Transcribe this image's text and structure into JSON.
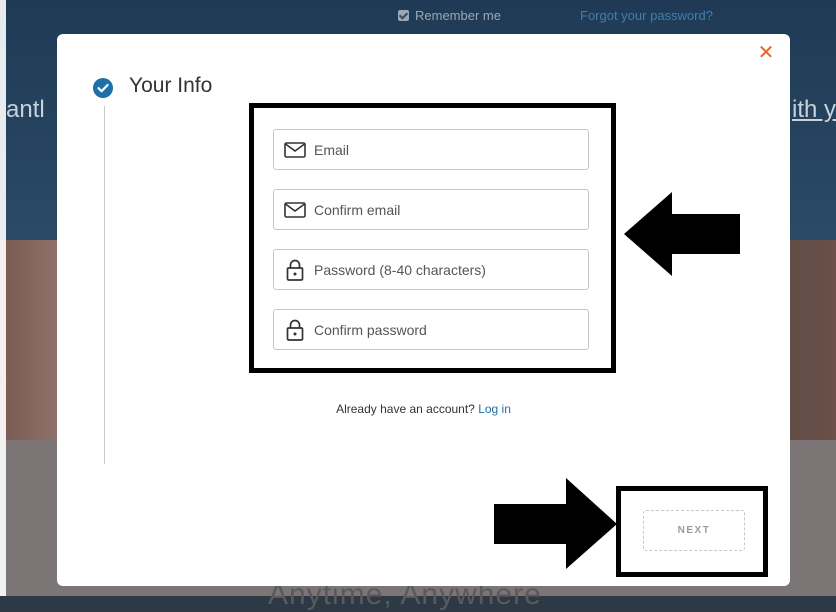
{
  "background": {
    "remember_label": "Remember me",
    "forgot_link": "Forgot your password?",
    "left_fragment": "antl",
    "right_fragment": "ith y",
    "tagline": "Anytime, Anywhere"
  },
  "modal": {
    "close_glyph": "✕",
    "step_title": "Your Info",
    "fields": [
      {
        "placeholder": "Email",
        "icon": "envelope-icon"
      },
      {
        "placeholder": "Confirm email",
        "icon": "envelope-icon"
      },
      {
        "placeholder": "Password (8-40 characters)",
        "icon": "lock-icon"
      },
      {
        "placeholder": "Confirm password",
        "icon": "lock-icon"
      }
    ],
    "login_prompt": "Already have an account?",
    "login_link": "Log in",
    "next_label": "NEXT"
  },
  "colors": {
    "accent": "#1f6fa8",
    "close": "#e8652a",
    "annotation": "#000000"
  }
}
